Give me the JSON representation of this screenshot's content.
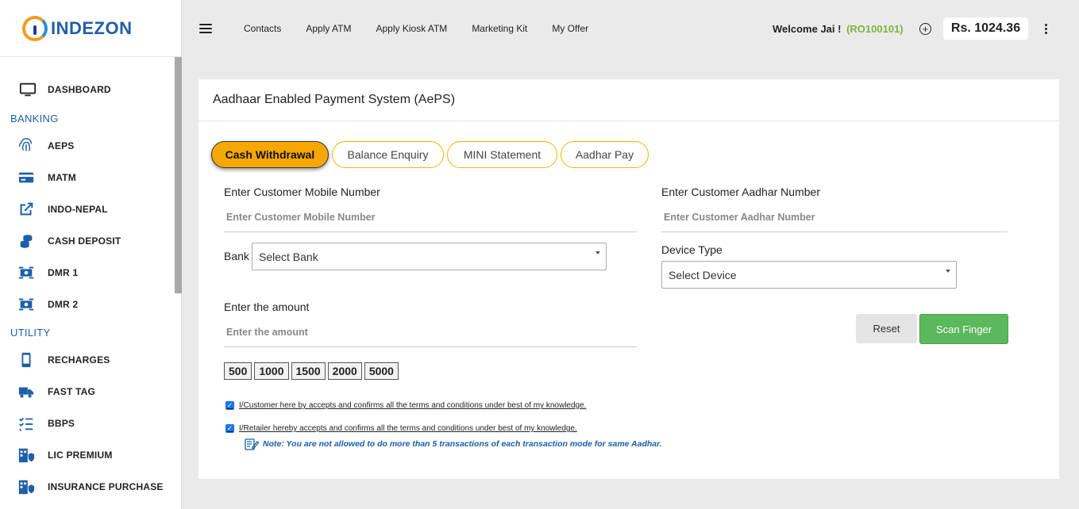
{
  "brand": {
    "name": "INDEZON"
  },
  "sidebar": {
    "dashboard": "DASHBOARD",
    "sections": [
      {
        "title": "BANKING",
        "items": [
          {
            "label": "AEPS",
            "icon": "fingerprint-icon"
          },
          {
            "label": "MATM",
            "icon": "card-icon"
          },
          {
            "label": "INDO-NEPAL",
            "icon": "external-link-icon"
          },
          {
            "label": "CASH DEPOSIT",
            "icon": "coins-icon"
          },
          {
            "label": "DMR 1",
            "icon": "money-transfer-icon"
          },
          {
            "label": "DMR 2",
            "icon": "money-transfer-icon"
          }
        ]
      },
      {
        "title": "UTILITY",
        "items": [
          {
            "label": "RECHARGES",
            "icon": "mobile-icon"
          },
          {
            "label": "FAST TAG",
            "icon": "truck-icon"
          },
          {
            "label": "BBPS",
            "icon": "checklist-icon"
          },
          {
            "label": "LIC PREMIUM",
            "icon": "building-shield-icon"
          },
          {
            "label": "INSURANCE PURCHASE",
            "icon": "building-shield-icon"
          }
        ]
      }
    ]
  },
  "topbar": {
    "links": [
      "Contacts",
      "Apply ATM",
      "Apply Kiosk ATM",
      "Marketing Kit",
      "My Offer"
    ],
    "welcome": "Welcome Jai !",
    "user_code": "(RO100101)",
    "balance": "Rs. 1024.36"
  },
  "card": {
    "title": "Aadhaar Enabled Payment System (AePS)",
    "tabs": [
      "Cash Withdrawal",
      "Balance Enquiry",
      "MINI Statement",
      "Aadhar Pay"
    ],
    "active_tab": "Cash Withdrawal",
    "mobile_label": "Enter Customer Mobile Number",
    "mobile_placeholder": "Enter Customer Mobile Number",
    "aadhar_label": "Enter Customer Aadhar Number",
    "aadhar_placeholder": "Enter Customer Aadhar Number",
    "bank_label": "Bank",
    "bank_select": "Select Bank",
    "device_label": "Device Type",
    "device_select": "Select Device",
    "amount_label": "Enter the amount",
    "amount_placeholder": "Enter the amount",
    "amount_chips": [
      "500",
      "1000",
      "1500",
      "2000",
      "5000"
    ],
    "reset_label": "Reset",
    "scan_label": "Scan Finger",
    "consent_customer": "I/Customer here by accepts and confirms all the terms and conditions under best of my knowledge.",
    "consent_retailer": "I/Retailer hereby accepts and confirms all the terms and conditions under best of my knowledge.",
    "note": "Note: You are not allowed to do more than 5 transactions of each transaction mode for same Aadhar."
  },
  "colors": {
    "brand_blue": "#1f5fa8",
    "tab_active": "#f7a800",
    "scan_green": "#5cb85c",
    "user_code_green": "#7cb342"
  }
}
